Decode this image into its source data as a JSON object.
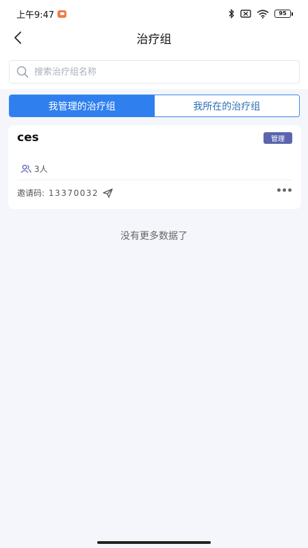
{
  "status_bar": {
    "time": "上午9:47",
    "battery": "95"
  },
  "nav": {
    "title": "治疗组"
  },
  "search": {
    "placeholder": "搜索治疗组名称",
    "value": ""
  },
  "tabs": [
    {
      "label": "我管理的治疗组",
      "active": true
    },
    {
      "label": "我所在的治疗组",
      "active": false
    }
  ],
  "groups": [
    {
      "name": "ces",
      "badge": "管理",
      "members": "3人",
      "invite_label": "邀请码:",
      "invite_code": "13370032"
    }
  ],
  "list_footer": "没有更多数据了",
  "colors": {
    "accent": "#2f7fef",
    "badge": "#5b65ad",
    "background": "#f4f6fb"
  }
}
